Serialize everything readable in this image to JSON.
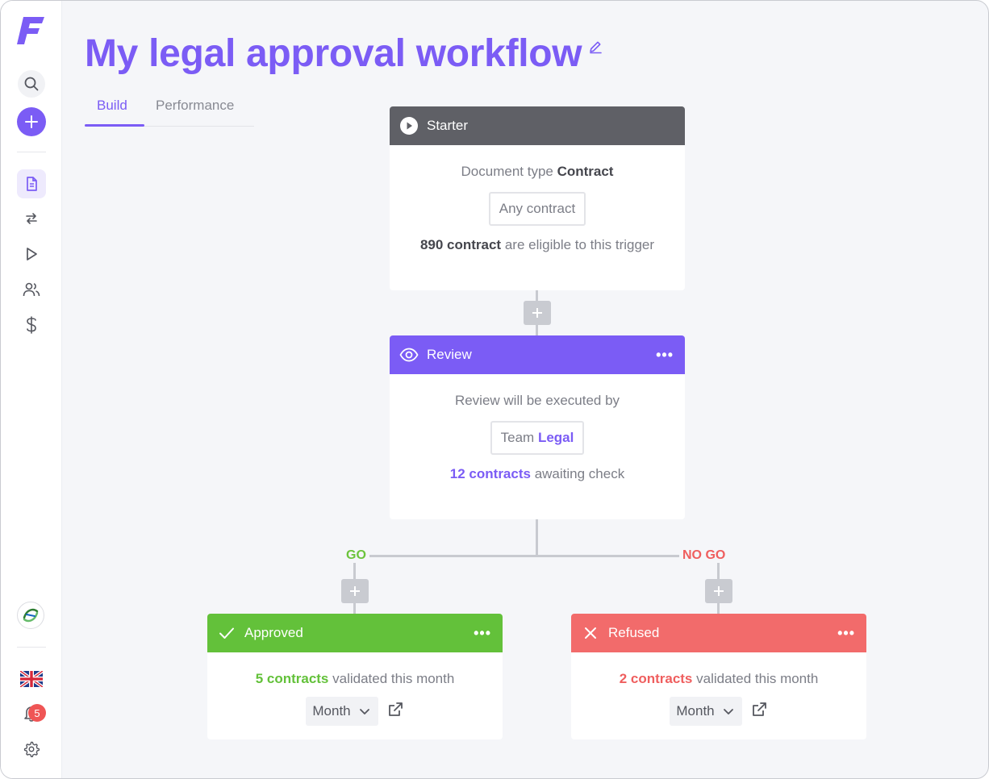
{
  "workflow": {
    "title": "My legal approval workflow",
    "tabs": [
      {
        "label": "Build",
        "active": true
      },
      {
        "label": "Performance",
        "active": false
      }
    ]
  },
  "sidebar": {
    "logo_letter": "F",
    "notification_count": "5",
    "icons": [
      "search-icon",
      "plus-icon",
      "document-icon",
      "swap-icon",
      "play-icon",
      "users-icon",
      "dollar-icon",
      "org-logo-icon",
      "uk-flag-icon",
      "bell-icon",
      "gear-icon"
    ]
  },
  "starter": {
    "header": "Starter",
    "line1_prefix": "Document type ",
    "line1_value": "Contract",
    "pill": "Any contract",
    "count": "890 contract",
    "count_suffix": " are eligible to this trigger"
  },
  "review": {
    "header": "Review",
    "line1": "Review will be executed by",
    "pill_prefix": "Team ",
    "pill_value": "Legal",
    "count": "12 contracts",
    "count_suffix": " awaiting check"
  },
  "branches": {
    "go_label": "GO",
    "nogo_label": "NO GO"
  },
  "approved": {
    "header": "Approved",
    "count": "5 contracts",
    "count_suffix": " validated this month",
    "period": "Month"
  },
  "refused": {
    "header": "Refused",
    "count": "2 contracts",
    "count_suffix": " validated this month",
    "period": "Month"
  },
  "colors": {
    "accent": "#7b5cf5",
    "starter": "#5f6066",
    "approved": "#63c13a",
    "refused": "#f26b6b"
  }
}
